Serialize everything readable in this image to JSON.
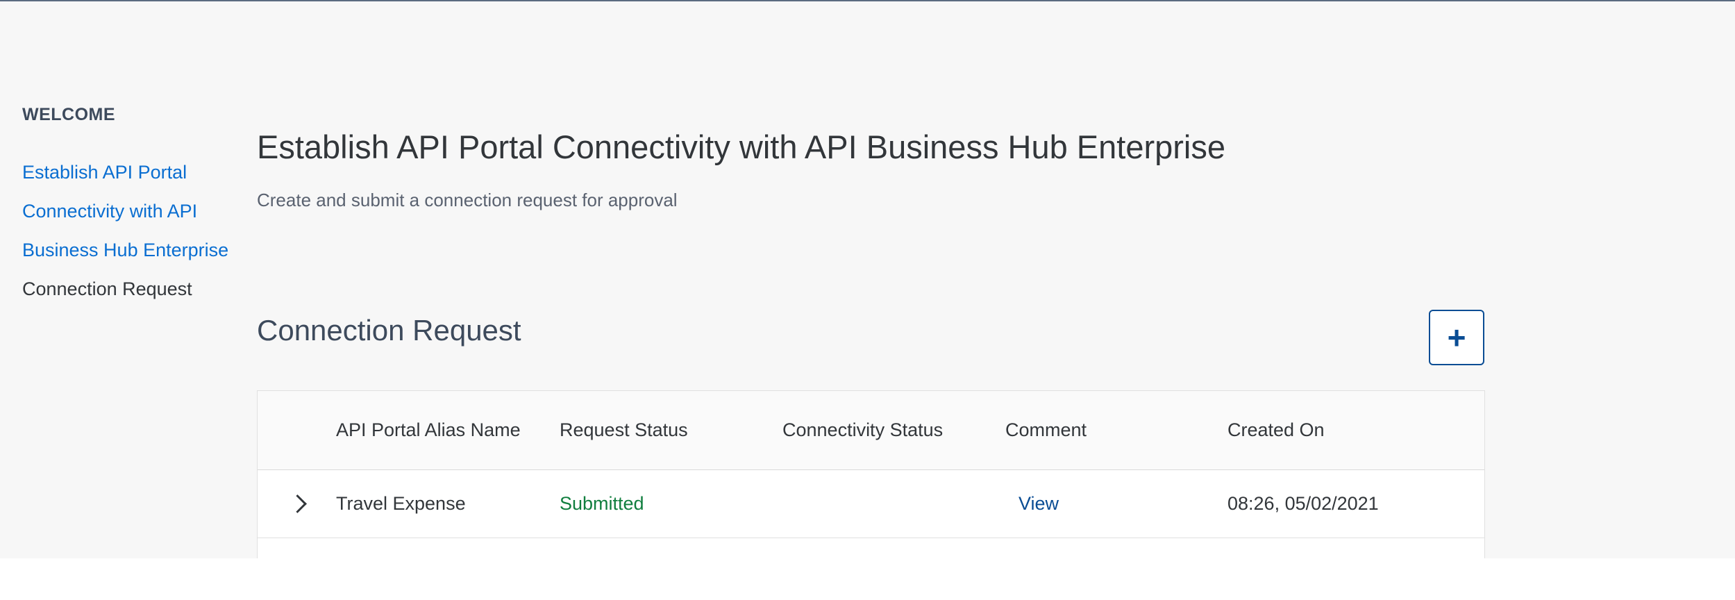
{
  "sidebar": {
    "heading": "WELCOME",
    "links": [
      "Establish API Portal",
      "Connectivity with API",
      "Business Hub Enterprise"
    ],
    "current": "Connection Request"
  },
  "header": {
    "title": "Establish API Portal Connectivity with API Business Hub Enterprise",
    "subtitle": "Create and submit a connection request for approval"
  },
  "section": {
    "title": "Connection Request",
    "add_button_label": "+"
  },
  "table": {
    "columns": [
      "API Portal Alias Name",
      "Request Status",
      "Connectivity Status",
      "Comment",
      "Created On"
    ],
    "rows": [
      {
        "alias": "Travel Expense",
        "request_status": "Submitted",
        "connectivity_status": "",
        "comment": "View",
        "created_on": "08:26, 05/02/2021"
      }
    ]
  },
  "colors": {
    "link": "#0a6ed1",
    "status_submitted": "#107e3e",
    "accent_border": "#0a4d94"
  }
}
